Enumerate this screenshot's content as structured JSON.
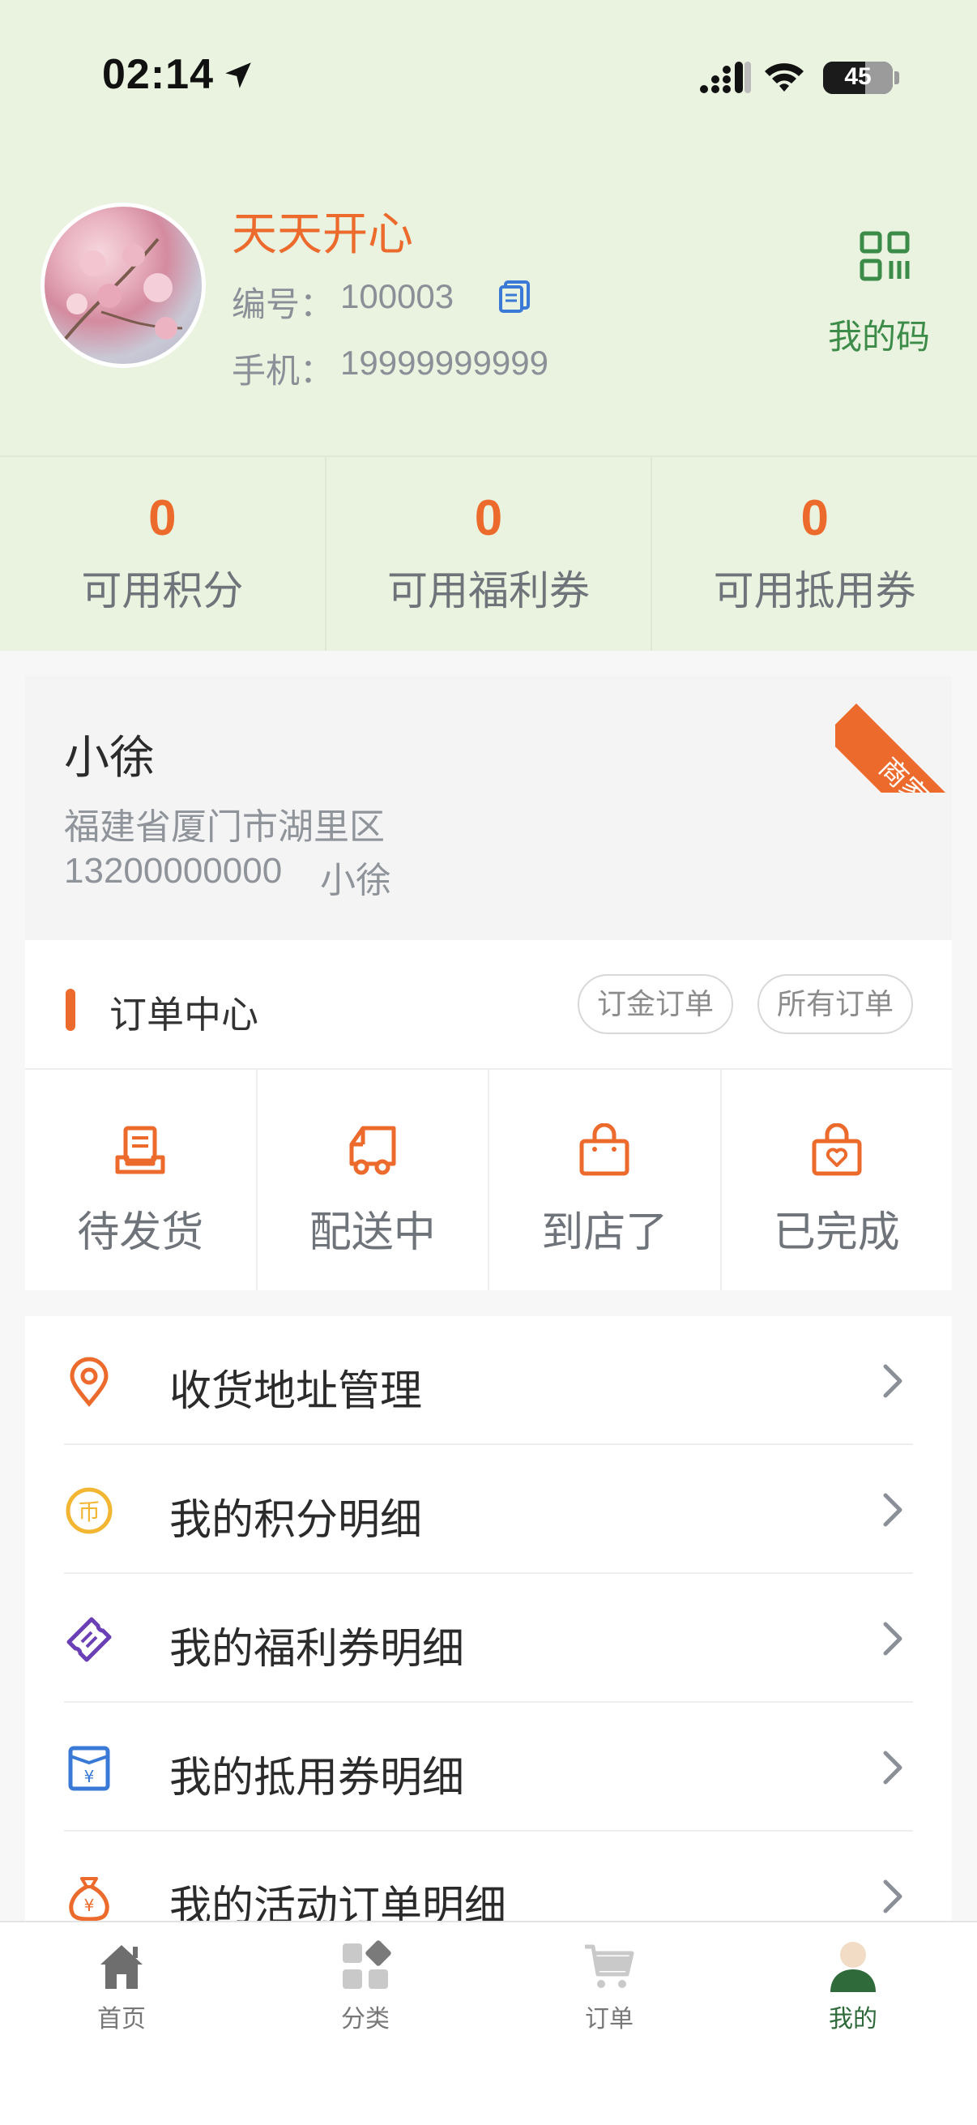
{
  "status_bar": {
    "time": "02:14",
    "battery": "45"
  },
  "profile": {
    "name": "天天开心",
    "id_label": "编号：",
    "id_value": "100003",
    "phone_label": "手机：",
    "phone_value": "19999999999",
    "qr_label": "我的码"
  },
  "stats": [
    {
      "value": "0",
      "label": "可用积分"
    },
    {
      "value": "0",
      "label": "可用福利券"
    },
    {
      "value": "0",
      "label": "可用抵用券"
    }
  ],
  "merchant": {
    "badge": "商家",
    "name": "小徐",
    "address": "福建省厦门市湖里区",
    "phone": "13200000000",
    "contact": "小徐"
  },
  "order_center": {
    "title": "订单中心",
    "deposit_orders": "订金订单",
    "all_orders": "所有订单",
    "statuses": [
      {
        "label": "待发货",
        "icon": "pending-shipment-icon"
      },
      {
        "label": "配送中",
        "icon": "delivery-truck-icon"
      },
      {
        "label": "到店了",
        "icon": "shopping-bag-icon"
      },
      {
        "label": "已完成",
        "icon": "completed-bag-icon"
      }
    ]
  },
  "menu": [
    {
      "label": "收货地址管理",
      "icon": "location-pin-icon"
    },
    {
      "label": "我的积分明细",
      "icon": "coin-icon"
    },
    {
      "label": "我的福利券明细",
      "icon": "ticket-icon"
    },
    {
      "label": "我的抵用券明细",
      "icon": "voucher-icon"
    },
    {
      "label": "我的活动订单明细",
      "icon": "money-bag-icon"
    }
  ],
  "tabbar": [
    {
      "label": "首页",
      "icon": "home-icon"
    },
    {
      "label": "分类",
      "icon": "category-icon"
    },
    {
      "label": "订单",
      "icon": "cart-icon"
    },
    {
      "label": "我的",
      "icon": "profile-icon"
    }
  ],
  "colors": {
    "accent": "#ec6a2c",
    "header_bg": "#e9f3df",
    "green": "#3d8b49"
  }
}
